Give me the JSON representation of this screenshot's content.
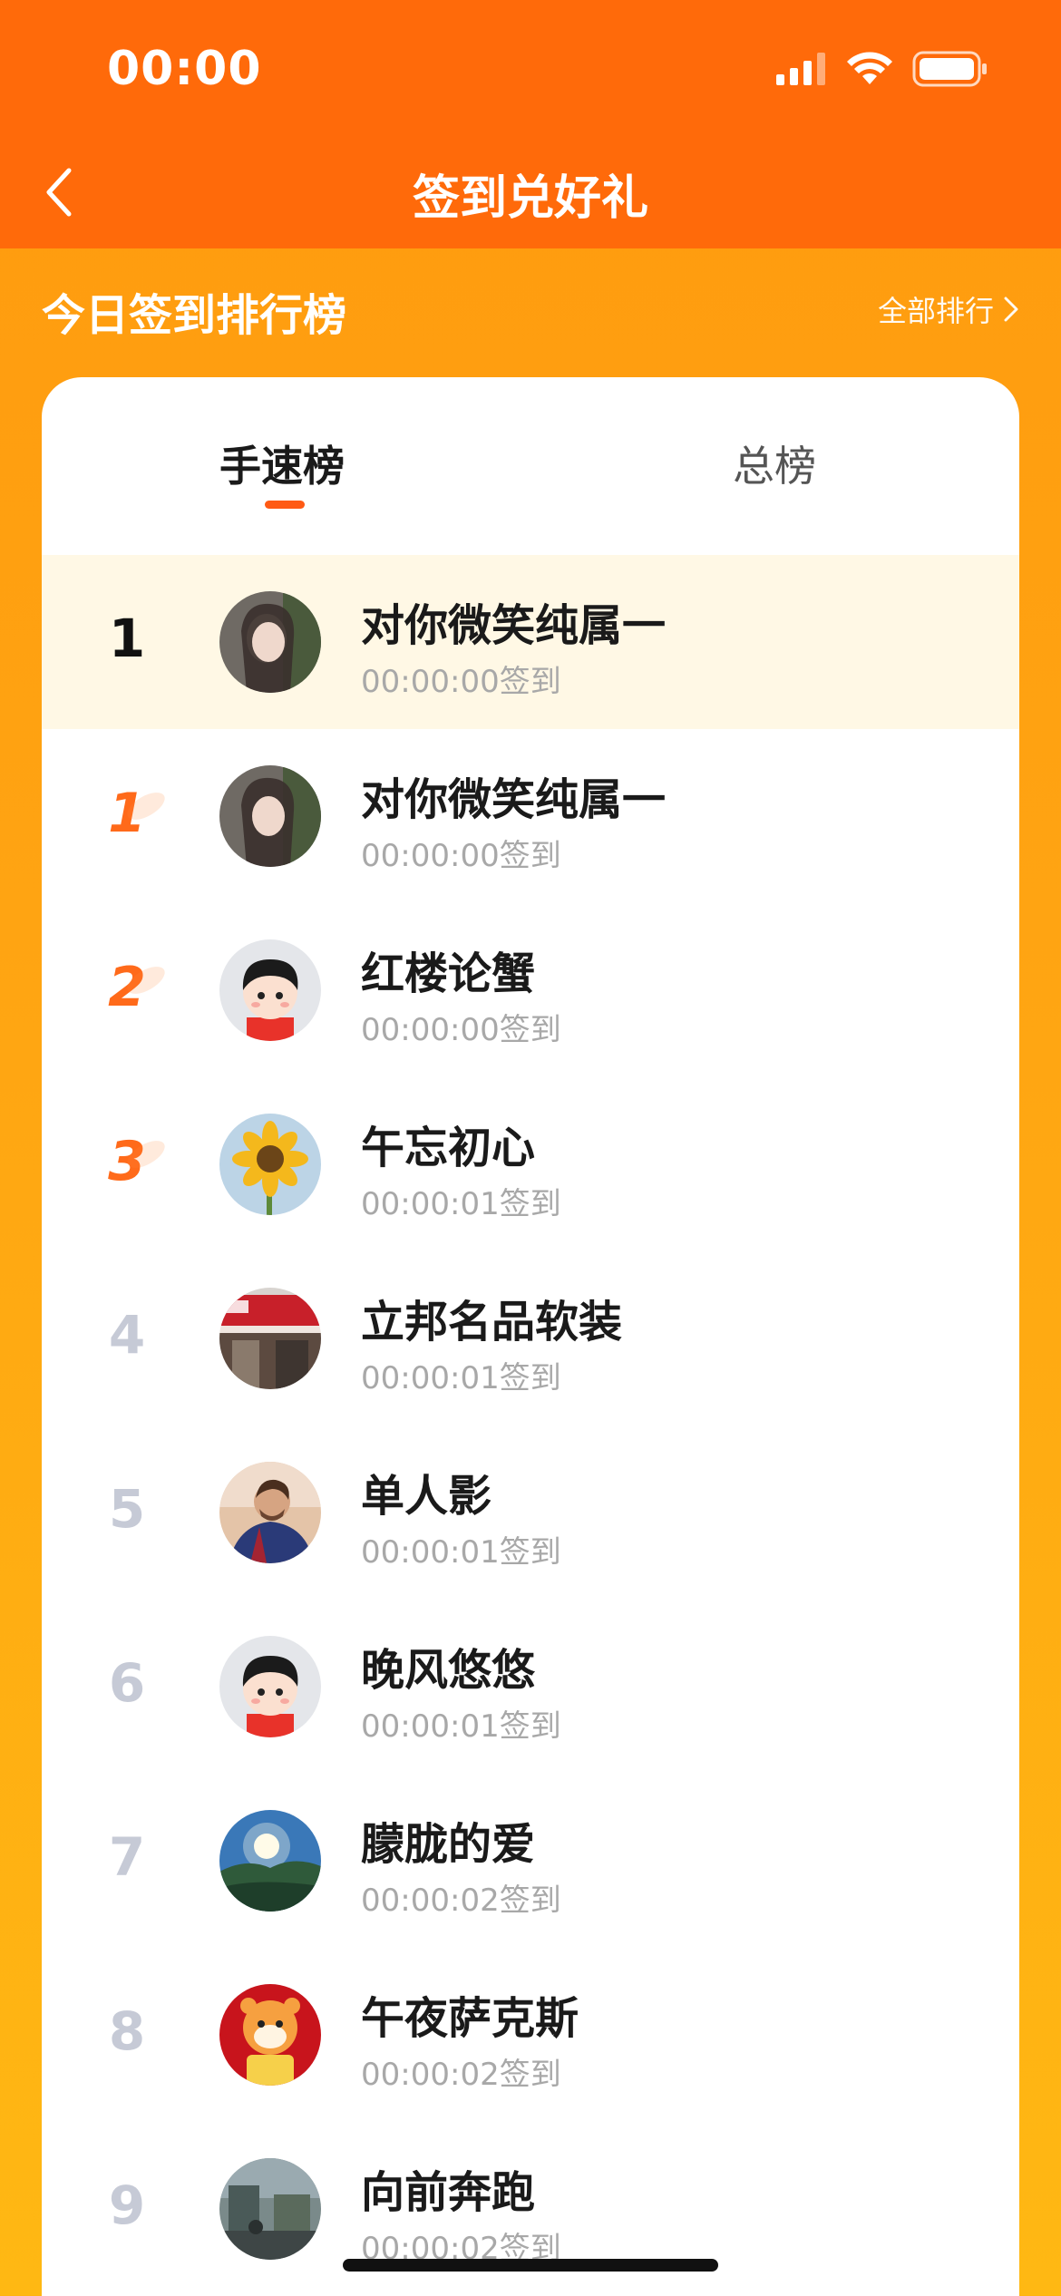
{
  "status": {
    "time": "00:00"
  },
  "nav": {
    "title": "签到兑好礼"
  },
  "section": {
    "title": "今日签到排行榜",
    "see_all": "全部排行"
  },
  "tabs": [
    {
      "label": "手速榜",
      "active": true
    },
    {
      "label": "总榜",
      "active": false
    }
  ],
  "colors": {
    "accent": "#ff6a0a",
    "medal": "#ff6a1a",
    "highlight_row": "#fff8e5"
  },
  "rows": [
    {
      "rank": "1",
      "name": "对你微笑纯属一",
      "time": "00:00:00签到",
      "avatar": "woman-photo-avatar",
      "mine": true
    },
    {
      "rank": "1",
      "name": "对你微笑纯属一",
      "time": "00:00:00签到",
      "avatar": "woman-photo-avatar"
    },
    {
      "rank": "2",
      "name": "红楼论蟹",
      "time": "00:00:00签到",
      "avatar": "cartoon-boy-avatar"
    },
    {
      "rank": "3",
      "name": "午忘初心",
      "time": "00:00:01签到",
      "avatar": "sunflower-avatar"
    },
    {
      "rank": "4",
      "name": "立邦名品软装",
      "time": "00:00:01签到",
      "avatar": "storefront-avatar"
    },
    {
      "rank": "5",
      "name": "单人影",
      "time": "00:00:01签到",
      "avatar": "footballer-avatar"
    },
    {
      "rank": "6",
      "name": "晚风悠悠",
      "time": "00:00:01签到",
      "avatar": "cartoon-boy-avatar"
    },
    {
      "rank": "7",
      "name": "朦胧的爱",
      "time": "00:00:02签到",
      "avatar": "sunburst-landscape-avatar"
    },
    {
      "rank": "8",
      "name": "午夜萨克斯",
      "time": "00:00:02签到",
      "avatar": "tiger-cartoon-avatar"
    },
    {
      "rank": "9",
      "name": "向前奔跑",
      "time": "00:00:02签到",
      "avatar": "street-photo-avatar"
    }
  ]
}
